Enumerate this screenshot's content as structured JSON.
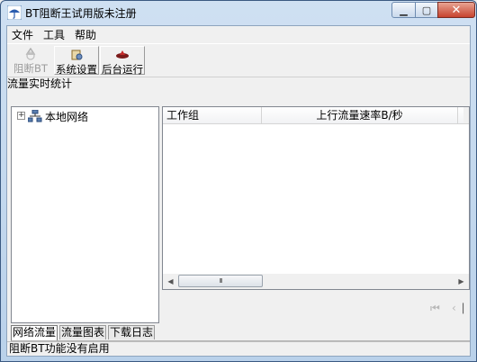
{
  "window": {
    "title": "BT阻断王试用版未注册"
  },
  "menu": [
    "文件",
    "工具",
    "帮助"
  ],
  "toolbar": {
    "block_bt": "阻断BT",
    "settings": "系统设置",
    "background": "后台运行"
  },
  "section_label": "流量实时统计",
  "tree": {
    "root_label": "本地网络"
  },
  "table": {
    "columns": [
      "工作组",
      "上行流量速率B/秒"
    ]
  },
  "pager": {
    "first": "⏮",
    "prev": "‹",
    "last_bar": "⎸"
  },
  "tabs": [
    "网络流量",
    "流量图表",
    "下载日志"
  ],
  "status": "阻断BT功能没有启用"
}
